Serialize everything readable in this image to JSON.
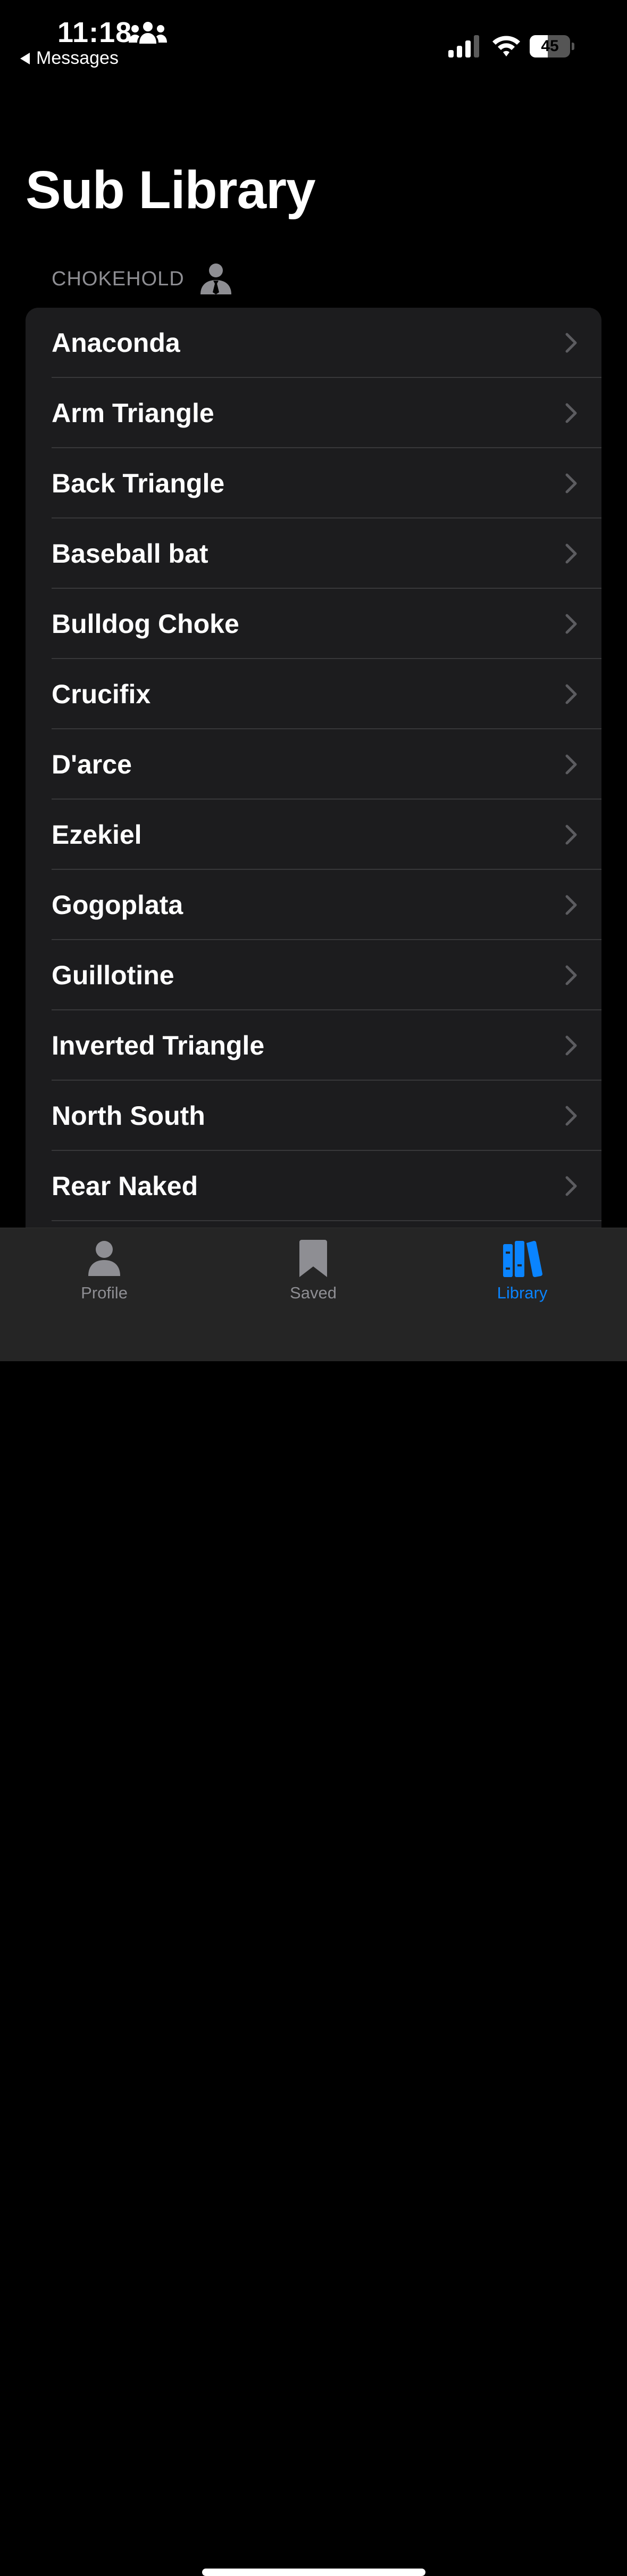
{
  "status_bar": {
    "time": "11:18",
    "back_app": "Messages",
    "battery_level": 45,
    "battery_text": "45"
  },
  "page_title": "Sub Library",
  "section": {
    "label": "CHOKEHOLD",
    "icon": "person-with-tie-icon"
  },
  "list": {
    "items": [
      "Anaconda",
      "Arm Triangle",
      "Back Triangle",
      "Baseball bat",
      "Bulldog Choke",
      "Crucifix",
      "D'arce",
      "Ezekiel",
      "Gogoplata",
      "Guillotine",
      "Inverted Triangle",
      "North South",
      "Rear Naked"
    ]
  },
  "tab_bar": {
    "tabs": [
      {
        "label": "Profile",
        "icon": "person-icon",
        "active": false
      },
      {
        "label": "Saved",
        "icon": "bookmark-icon",
        "active": false
      },
      {
        "label": "Library",
        "icon": "books-icon",
        "active": true
      }
    ]
  },
  "colors": {
    "background": "#000000",
    "card": "#1c1c1e",
    "separator": "#38383a",
    "secondary_text": "#8e8e93",
    "accent": "#0a84ff",
    "tab_bar": "#252525"
  }
}
